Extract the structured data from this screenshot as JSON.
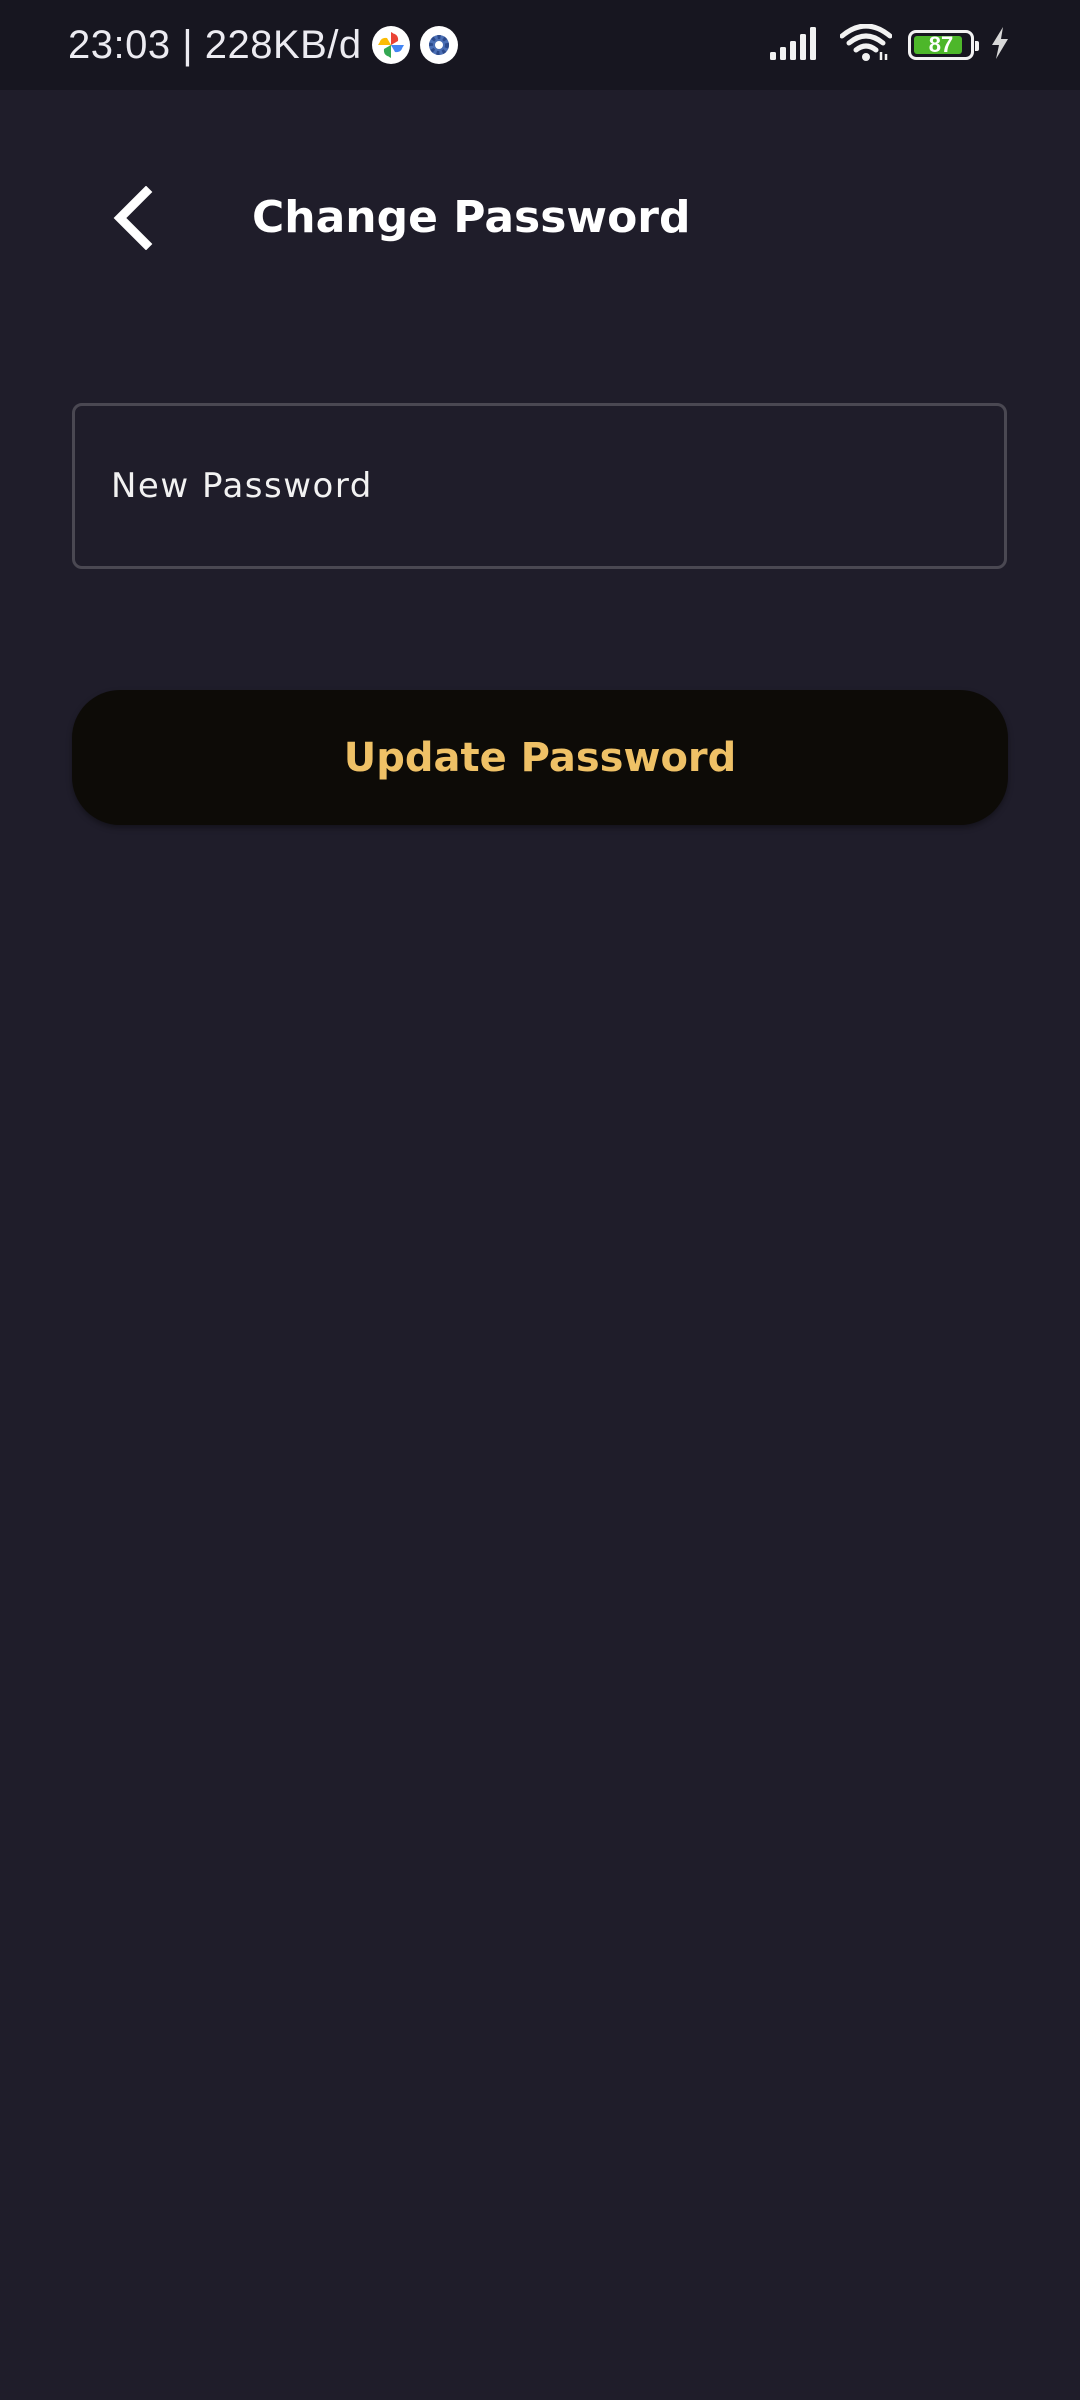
{
  "status_bar": {
    "time_info": "23:03 | 228KB/d",
    "notification_icons": [
      "photos-pinwheel-icon",
      "settings-gear-icon"
    ],
    "signal_icon": "cellular-signal-icon",
    "wifi_icon": "wifi-icon",
    "battery_level": "87",
    "battery_fill_color": "#4db72a",
    "charging_icon": "lightning-bolt-icon"
  },
  "header": {
    "back_icon": "chevron-left-icon",
    "title": "Change Password"
  },
  "form": {
    "new_password": {
      "placeholder": "New Password",
      "value": ""
    },
    "submit_label": "Update Password"
  },
  "colors": {
    "background": "#1f1d2a",
    "status_bar_background": "#171620",
    "button_background": "#0d0b07",
    "button_text": "#efc166",
    "field_border": "#4a4852"
  }
}
